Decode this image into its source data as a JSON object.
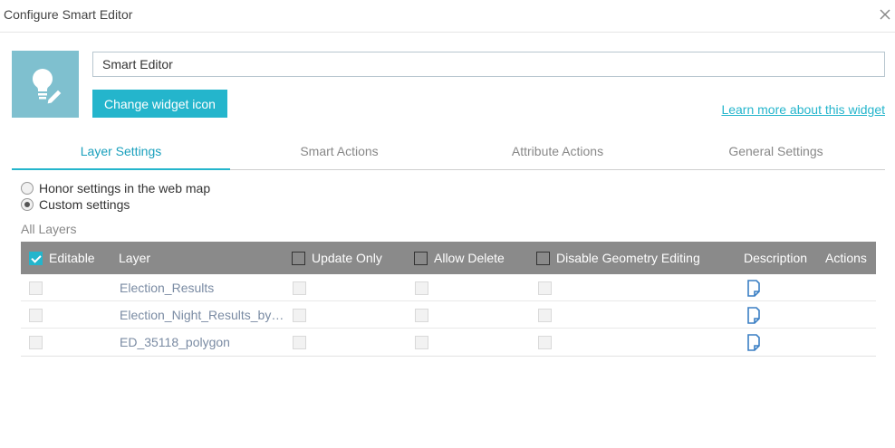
{
  "dialog": {
    "title": "Configure Smart Editor"
  },
  "widget": {
    "name_value": "Smart Editor",
    "change_icon_label": "Change widget icon",
    "learn_more_label": "Learn more about this widget"
  },
  "tabs": [
    {
      "label": "Layer Settings",
      "active": true
    },
    {
      "label": "Smart Actions",
      "active": false
    },
    {
      "label": "Attribute Actions",
      "active": false
    },
    {
      "label": "General Settings",
      "active": false
    }
  ],
  "settings_mode": {
    "options": [
      {
        "label": "Honor settings in the web map",
        "checked": false
      },
      {
        "label": "Custom settings",
        "checked": true
      }
    ]
  },
  "layers_section": {
    "title": "All Layers"
  },
  "table": {
    "columns": {
      "editable": "Editable",
      "layer": "Layer",
      "update_only": "Update Only",
      "allow_delete": "Allow Delete",
      "disable_geometry": "Disable Geometry Editing",
      "description": "Description",
      "actions": "Actions"
    },
    "rows": [
      {
        "layer": "Election_Results"
      },
      {
        "layer": "Election_Night_Results_by_Precinct"
      },
      {
        "layer": "ED_35118_polygon"
      }
    ]
  },
  "colors": {
    "accent": "#24b5cc",
    "header_bg": "#8a8a8a",
    "icon_bg": "#7fc0cf"
  },
  "icons": {
    "widget": "lightbulb-pencil-icon",
    "description": "document-edit-icon",
    "close": "close-icon"
  }
}
